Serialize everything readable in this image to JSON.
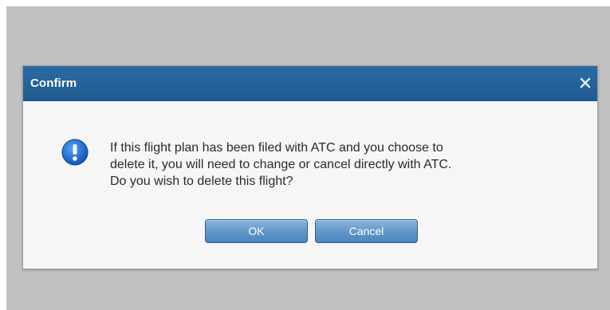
{
  "dialog": {
    "title": "Confirm",
    "close_label": "×",
    "message_lines": [
      "If this flight plan has been filed with ATC and you choose to",
      "delete it, you will need to change or cancel directly with ATC.",
      "Do you wish to delete this flight?"
    ],
    "icon": "info-icon",
    "buttons": {
      "ok_label": "OK",
      "cancel_label": "Cancel"
    }
  },
  "colors": {
    "titlebar": "#2265a0",
    "button": "#5f95c7",
    "icon": "#1f6fd1",
    "backdrop": "#c2c2c2"
  }
}
